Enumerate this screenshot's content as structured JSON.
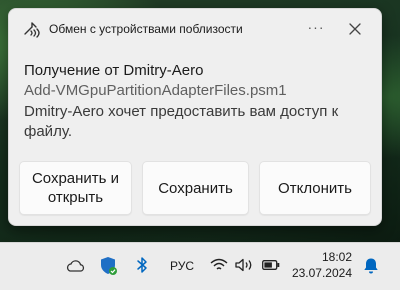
{
  "notification": {
    "app_name": "Обмен с устройствами поблизости",
    "more_label": "···",
    "title": "Получение от Dmitry-Aero",
    "filename": "Add-VMGpuPartitionAdapterFiles.psm1",
    "message": "Dmitry-Aero хочет предоставить вам доступ к файлу.",
    "buttons": {
      "save_open": "Сохранить и открыть",
      "save": "Сохранить",
      "decline": "Отклонить"
    }
  },
  "taskbar": {
    "language": "РУС",
    "time": "18:02",
    "date": "23.07.2024",
    "icons": [
      "onedrive-cloud-icon",
      "windows-security-icon",
      "bluetooth-icon",
      "wifi-icon",
      "volume-icon",
      "battery-icon",
      "notification-bell-icon"
    ]
  },
  "colors": {
    "accent": "#0067c0",
    "security_green": "#2e9d3a",
    "toast_bg": "#efefef",
    "taskbar_bg": "#ececec"
  }
}
